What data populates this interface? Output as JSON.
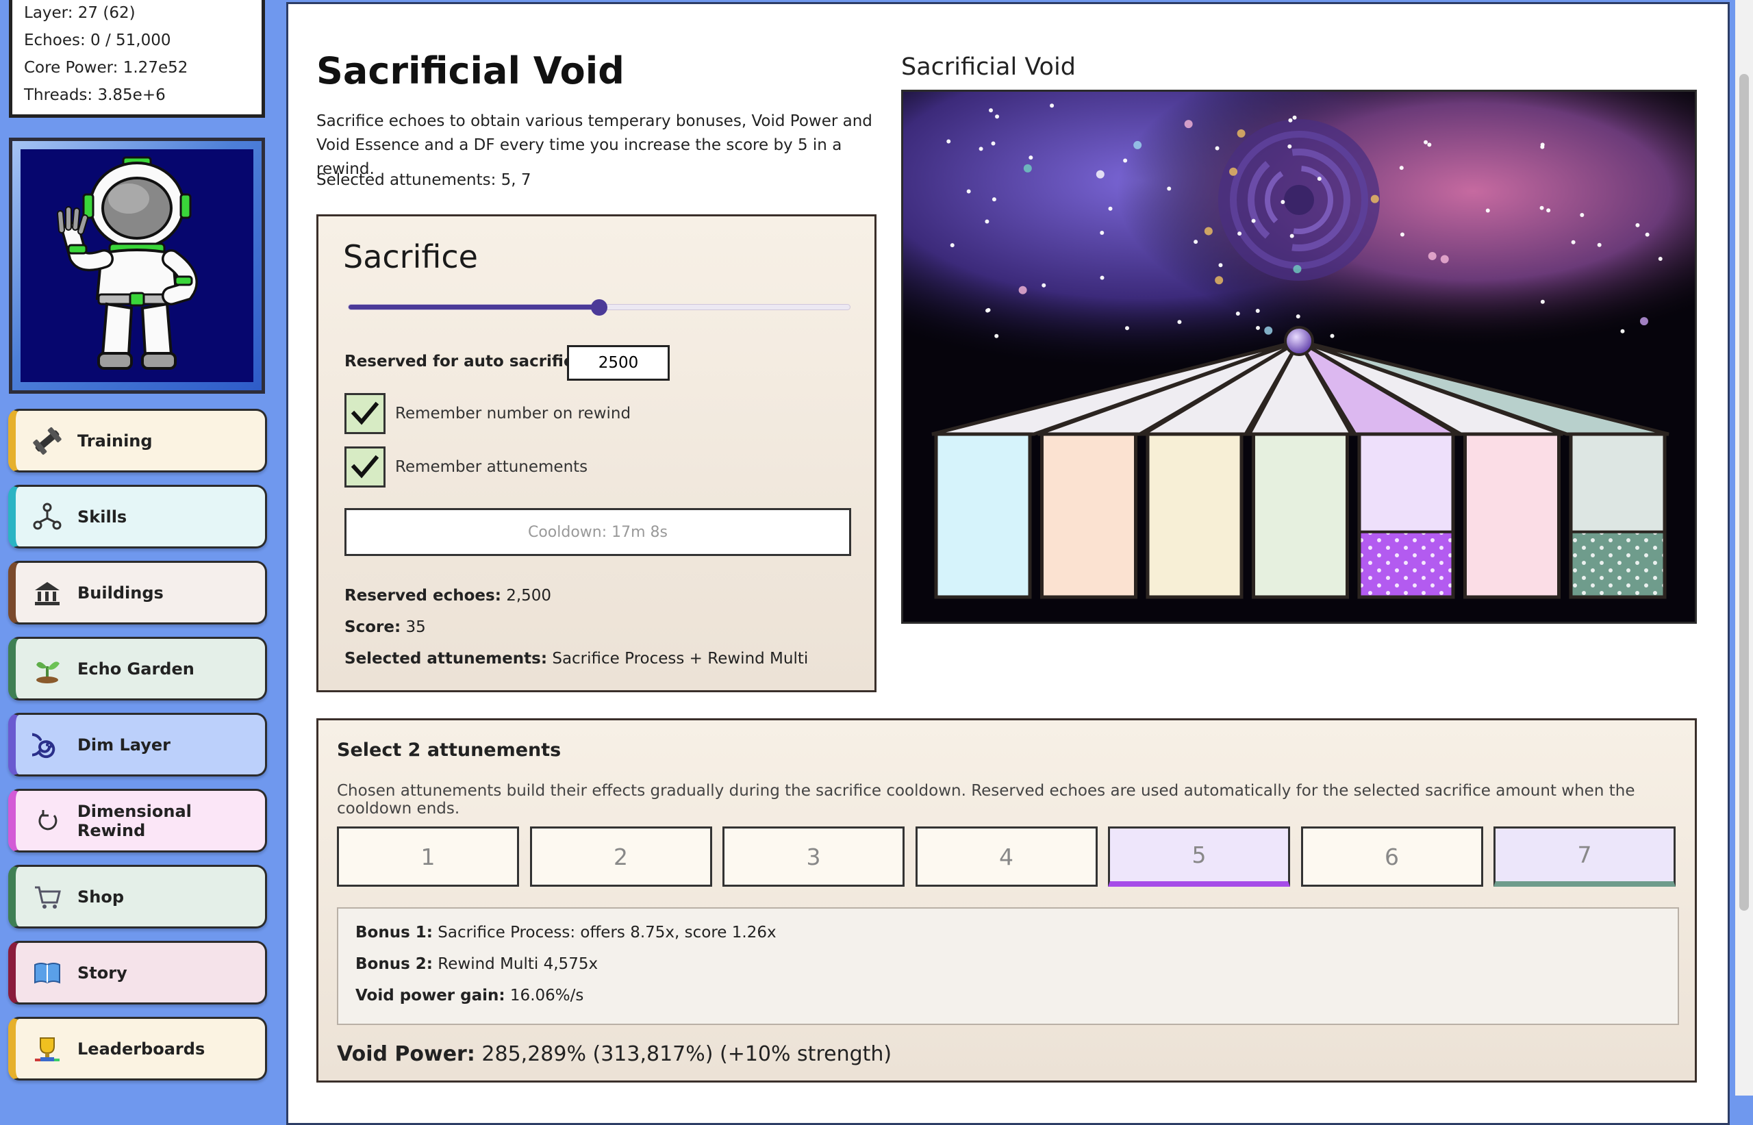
{
  "stats": {
    "layer": "Layer: 27 (62)",
    "echoes": "Echoes: 0 / 51,000",
    "core_power": "Core Power: 1.27e52",
    "threads": "Threads: 3.85e+6"
  },
  "nav": [
    {
      "label": "Training",
      "icon": "dumbbell-icon",
      "bg": "#fbf3e2",
      "accent": "#e6b02c"
    },
    {
      "label": "Skills",
      "icon": "skills-tree-icon",
      "bg": "#e5f6f7",
      "accent": "#2bb4c4"
    },
    {
      "label": "Buildings",
      "icon": "building-icon",
      "bg": "#f5efec",
      "accent": "#7a4a2c"
    },
    {
      "label": "Echo Garden",
      "icon": "sprout-icon",
      "bg": "#e4efe8",
      "accent": "#3f7f54"
    },
    {
      "label": "Dim Layer",
      "icon": "spiral-icon",
      "bg": "#bcd0fb",
      "accent": "#6a5ad0"
    },
    {
      "label": "Dimensional Rewind",
      "icon": "rewind-icon",
      "bg": "#fbe6f7",
      "accent": "#d35bd6"
    },
    {
      "label": "Shop",
      "icon": "cart-icon",
      "bg": "#e4efe8",
      "accent": "#3f7f54"
    },
    {
      "label": "Story",
      "icon": "book-icon",
      "bg": "#f5e3ea",
      "accent": "#8a1c3c"
    },
    {
      "label": "Leaderboards",
      "icon": "trophy-icon",
      "bg": "#fbf3e2",
      "accent": "#e6b02c"
    }
  ],
  "main": {
    "title": "Sacrificial Void",
    "description": "Sacrifice echoes to obtain various temperary bonuses, Void Power and Void Essence and a DF every time you increase the score by 5 in a rewind.",
    "selected_attunements_line": "Selected attunements: 5, 7"
  },
  "sacrifice": {
    "title": "Sacrifice",
    "slider_fraction": 0.5,
    "reserve_label": "Reserved for auto sacrifice",
    "reserve_value": "2500",
    "remember_number_label": "Remember number on rewind",
    "remember_number_checked": true,
    "remember_attunements_label": "Remember attunements",
    "remember_attunements_checked": true,
    "cooldown_label": "Cooldown: 17m 8s",
    "reserved_echoes_key": "Reserved echoes:",
    "reserved_echoes_value": "2,500",
    "score_key": "Score:",
    "score_value": "35",
    "selected_attunements_key": "Selected attunements:",
    "selected_attunements_value": "Sacrifice Process + Rewind Multi"
  },
  "void_art": {
    "heading": "Sacrificial Void",
    "column_colors": [
      "#d6f3fb",
      "#fbe2d1",
      "#f7efd6",
      "#e6f0df",
      "#eee0fb",
      "#fbdde6",
      "#dde6e3"
    ],
    "column_fill_levels": [
      0,
      0,
      0,
      0,
      0.4,
      0,
      0.4
    ],
    "fill_colors": [
      "",
      "",
      "",
      "",
      "#b35bf0",
      "",
      "#6f9c8c"
    ]
  },
  "attunements": {
    "title": "Select 2 attunements",
    "description": "Chosen attunements build their effects gradually during the sacrifice cooldown. Reserved echoes are used automatically for the selected sacrifice amount when the cooldown ends.",
    "options": [
      {
        "label": "1",
        "selected": false,
        "bg": "#fdf9f1",
        "bar": ""
      },
      {
        "label": "2",
        "selected": false,
        "bg": "#fdf9f1",
        "bar": ""
      },
      {
        "label": "3",
        "selected": false,
        "bg": "#fdf9f1",
        "bar": ""
      },
      {
        "label": "4",
        "selected": false,
        "bg": "#fdf9f1",
        "bar": ""
      },
      {
        "label": "5",
        "selected": true,
        "bg": "#eee6fb",
        "bar": "#a64ce8"
      },
      {
        "label": "6",
        "selected": false,
        "bg": "#fdf9f1",
        "bar": ""
      },
      {
        "label": "7",
        "selected": true,
        "bg": "#ece6fa",
        "bar": "#6f9c8c"
      }
    ],
    "bonus1_key": "Bonus 1:",
    "bonus1_value": "Sacrifice Process: offers 8.75x, score 1.26x",
    "bonus2_key": "Bonus 2:",
    "bonus2_value": "Rewind Multi 4,575x",
    "void_gain_key": "Void power gain:",
    "void_gain_value": "16.06%/s",
    "void_power_key": "Void Power:",
    "void_power_value": "285,289% (313,817%) (+10% strength)"
  }
}
